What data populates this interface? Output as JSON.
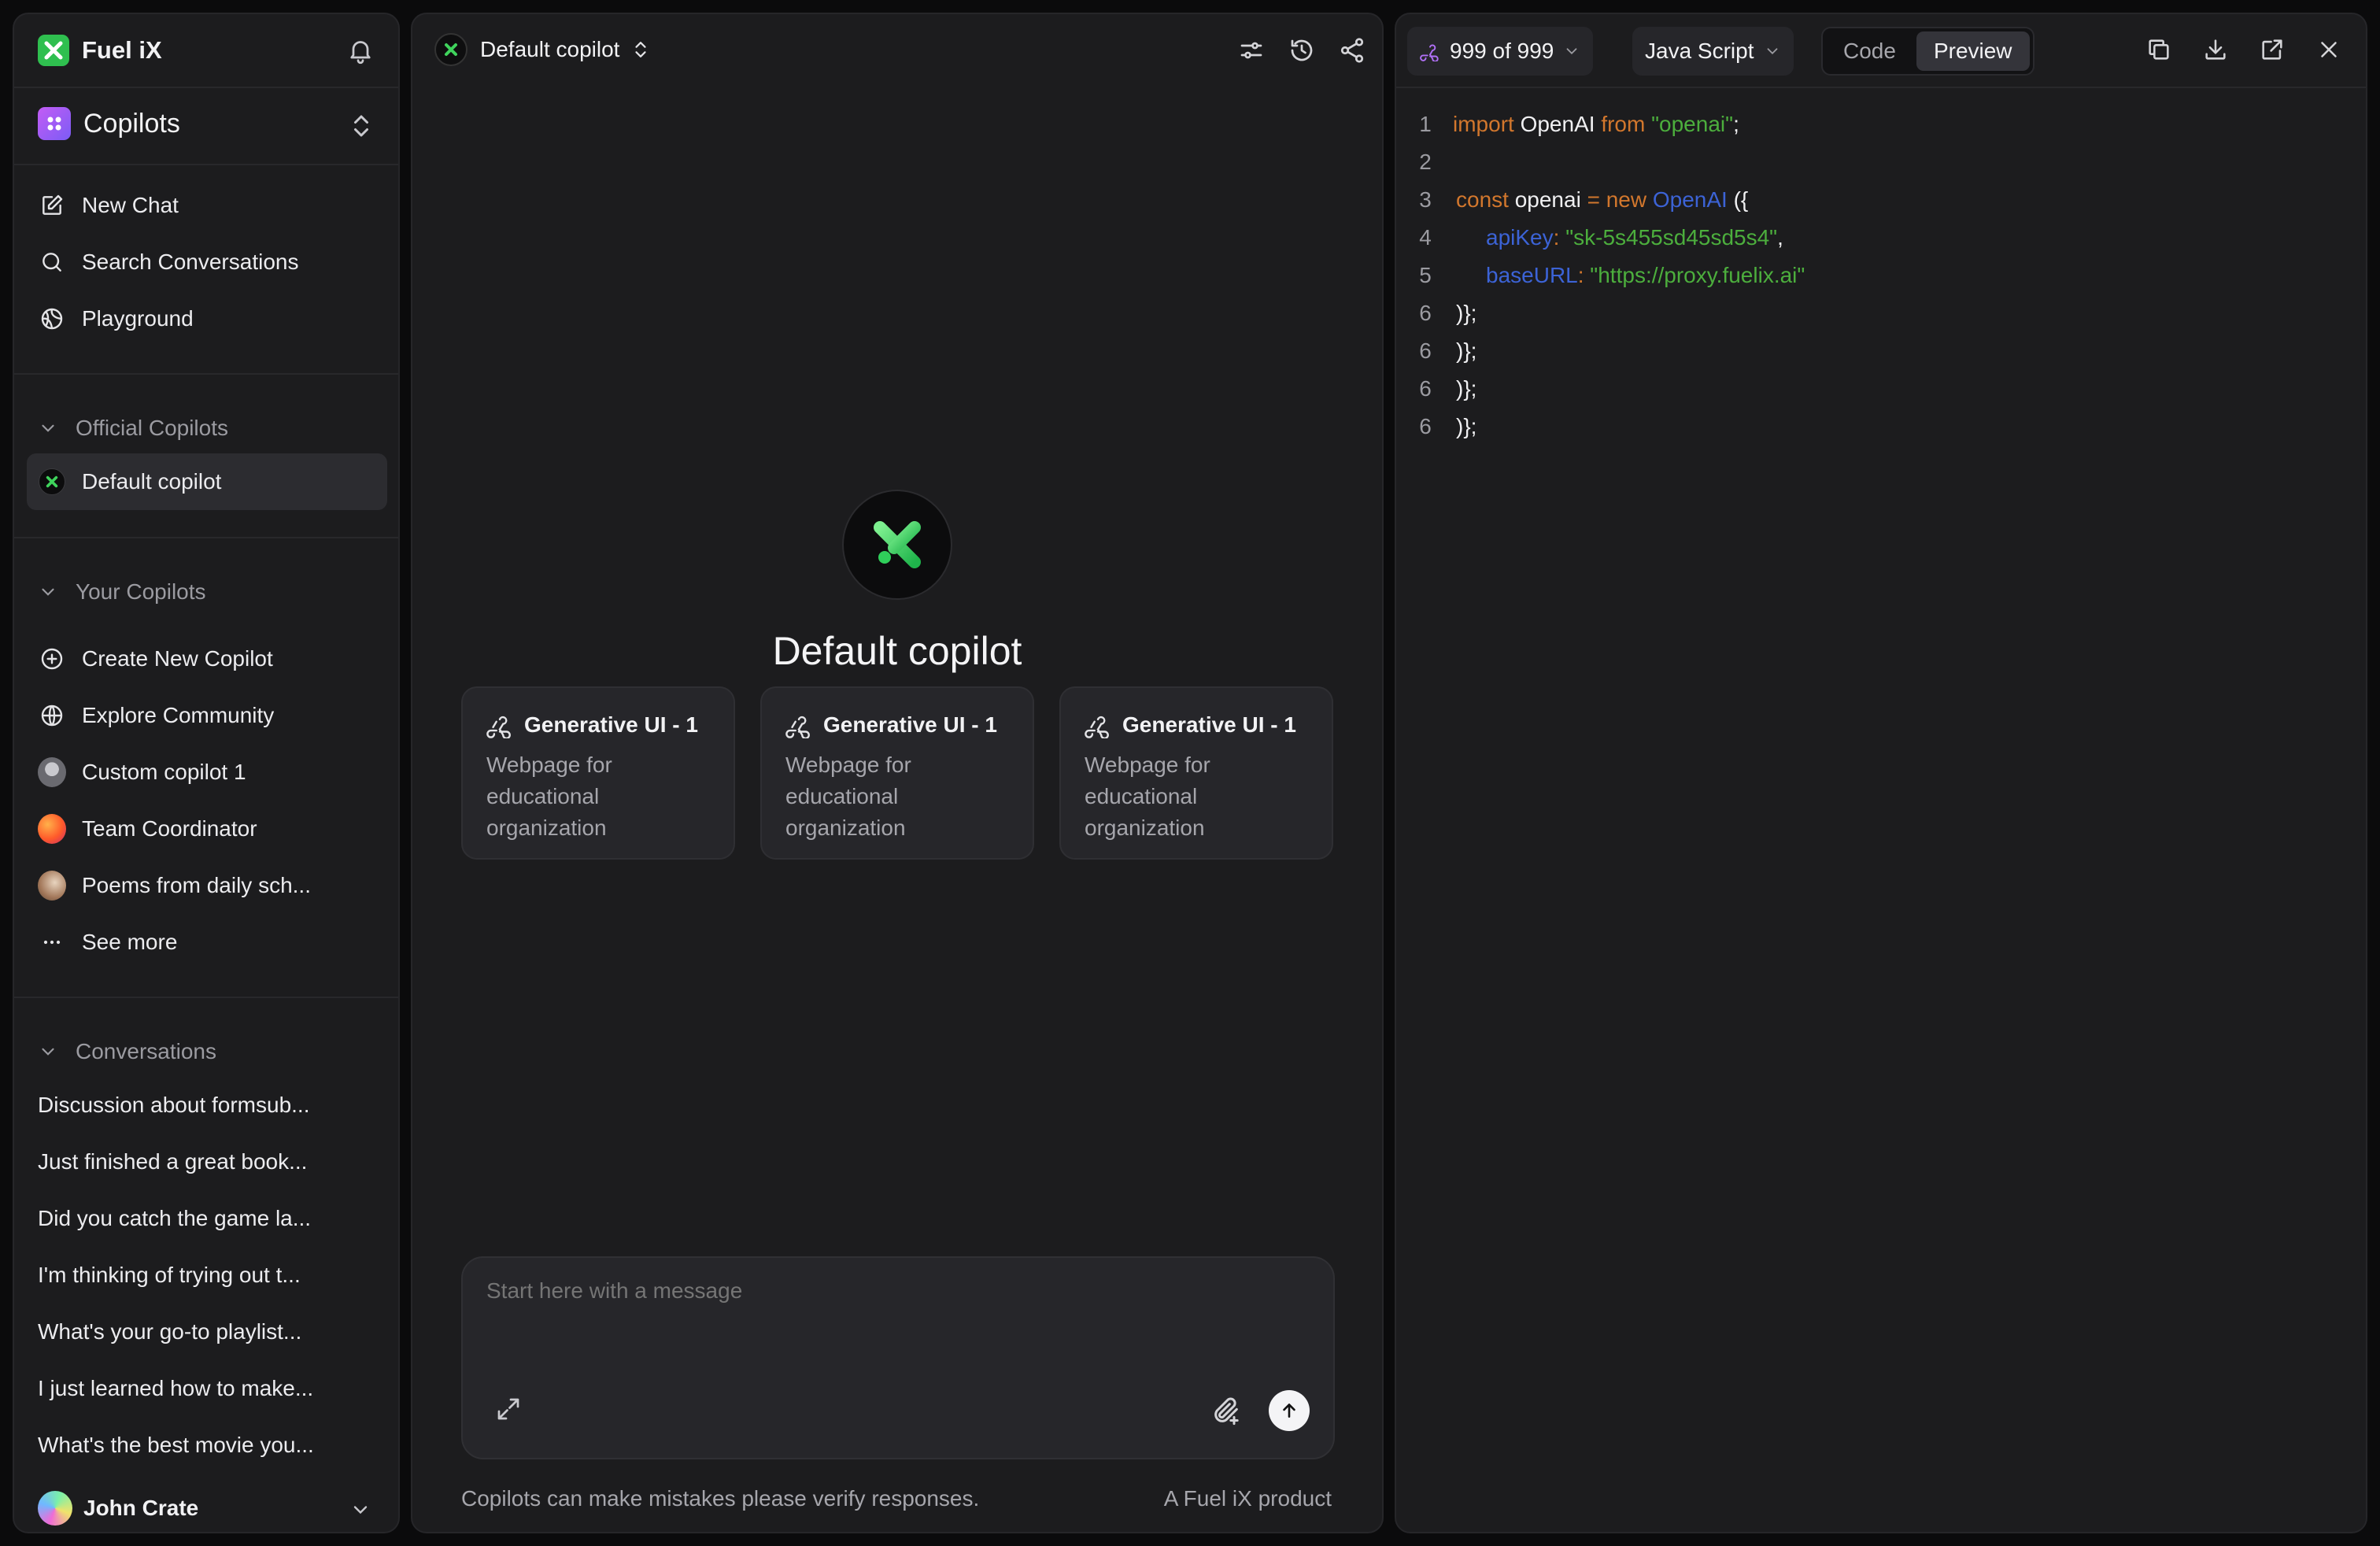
{
  "sidebar": {
    "brand": "Fuel iX",
    "selector": "Copilots",
    "nav": [
      {
        "label": "New Chat",
        "icon": "edit-icon"
      },
      {
        "label": "Search Conversations",
        "icon": "search-icon"
      },
      {
        "label": "Playground",
        "icon": "playground-icon"
      }
    ],
    "official_header": "Official Copilots",
    "official_items": [
      {
        "label": "Default copilot"
      }
    ],
    "your_header": "Your Copilots",
    "your_items": [
      {
        "label": "Create New Copilot",
        "icon": "plus-circle-icon"
      },
      {
        "label": "Explore Community",
        "icon": "globe-icon"
      },
      {
        "label": "Custom copilot 1",
        "icon": "avatar-icon"
      },
      {
        "label": "Team Coordinator",
        "icon": "avatar-icon"
      },
      {
        "label": "Poems from daily sch...",
        "icon": "avatar-icon"
      },
      {
        "label": "See more",
        "icon": "more-icon"
      }
    ],
    "conversations_header": "Conversations",
    "conversations": [
      "Discussion about formsub...",
      "Just finished a great book...",
      "Did you catch the game la...",
      "I'm thinking of trying out t...",
      "What's your go-to playlist...",
      "I just learned how to make...",
      "What's the best movie you..."
    ],
    "user": "John Crate"
  },
  "chat": {
    "title": "Default copilot",
    "hero_title": "Default copilot",
    "cards": [
      {
        "title": "Generative UI - 1",
        "desc": "Webpage for educational organization"
      },
      {
        "title": "Generative UI - 1",
        "desc": "Webpage for educational organization"
      },
      {
        "title": "Generative UI - 1",
        "desc": "Webpage for educational organization"
      }
    ],
    "input_placeholder": "Start here with a message",
    "disclaimer": "Copilots can make mistakes please verify responses.",
    "product": "A Fuel iX product"
  },
  "code_panel": {
    "version": "999 of 999",
    "language": "Java Script",
    "tabs": [
      "Code",
      "Preview"
    ],
    "active_tab": "Preview",
    "line_numbers": [
      "1",
      "2",
      "3",
      "4",
      "5",
      "6",
      "6",
      "6",
      "6"
    ],
    "code": {
      "l1": {
        "kw_import": "import",
        "name": " OpenAI ",
        "kw_from": "from",
        "str": " \"openai\"",
        "end": ";"
      },
      "l3": {
        "kw_const": "const",
        "name": " openai ",
        "eq": "= ",
        "kw_new": "new",
        "cls": " OpenAI",
        "end": " ({"
      },
      "l4": {
        "key": "apiKey",
        "colon": ": ",
        "val": "\"sk-5s455sd45sd5s4\"",
        "end": ","
      },
      "l5": {
        "key": "baseURL",
        "colon": ": ",
        "val": "\"https://proxy.fuelix.ai\""
      },
      "l6": ")};",
      "l7": ")};",
      "l8": ")};",
      "l9": ")};"
    }
  },
  "colors": {
    "brand_green": "#2fbf4f",
    "keyword": "#d2772d",
    "string": "#4cae3d",
    "identifier": "#3c63d6"
  }
}
